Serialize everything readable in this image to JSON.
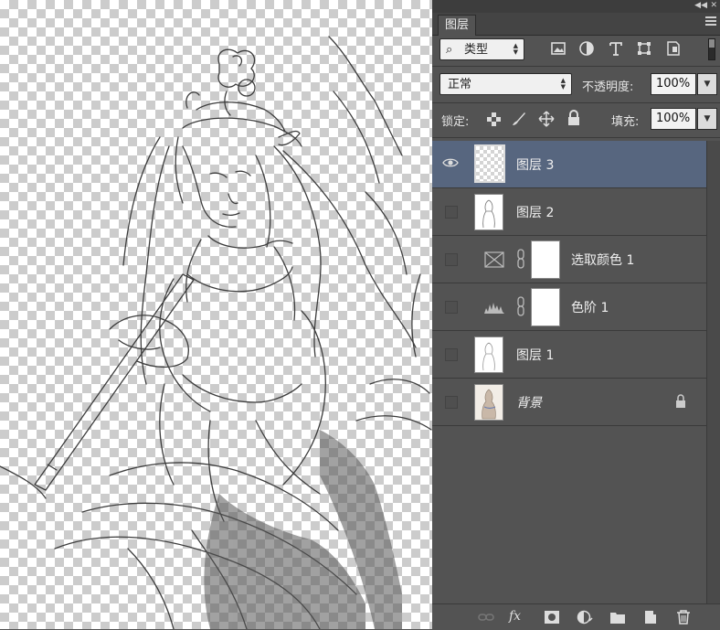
{
  "panel": {
    "tab_label": "图层",
    "filter": {
      "search_glyph": "⌕",
      "selected": "类型"
    },
    "blend_mode": "正常",
    "opacity": {
      "label": "不透明度:",
      "value": "100%"
    },
    "lock": {
      "label": "锁定:"
    },
    "fill": {
      "label": "填充:",
      "value": "100%"
    },
    "layers": [
      {
        "name": "图层 3",
        "visible": true,
        "selected": true,
        "kind": "pixel-transparent"
      },
      {
        "name": "图层 2",
        "visible": false,
        "selected": false,
        "kind": "pixel-sketch"
      },
      {
        "name": "选取颜色 1",
        "visible": false,
        "selected": false,
        "kind": "adjustment-selective-color"
      },
      {
        "name": "色阶 1",
        "visible": false,
        "selected": false,
        "kind": "adjustment-levels"
      },
      {
        "name": "图层 1",
        "visible": false,
        "selected": false,
        "kind": "pixel-sketch"
      },
      {
        "name": "背景",
        "visible": false,
        "selected": false,
        "kind": "background-locked"
      }
    ],
    "bottom_icons": [
      "link-layers-icon",
      "fx-icon",
      "add-mask-icon",
      "adjustment-layer-icon",
      "new-group-icon",
      "new-layer-icon",
      "delete-layer-icon"
    ],
    "bottom_fx_label": "fx"
  }
}
